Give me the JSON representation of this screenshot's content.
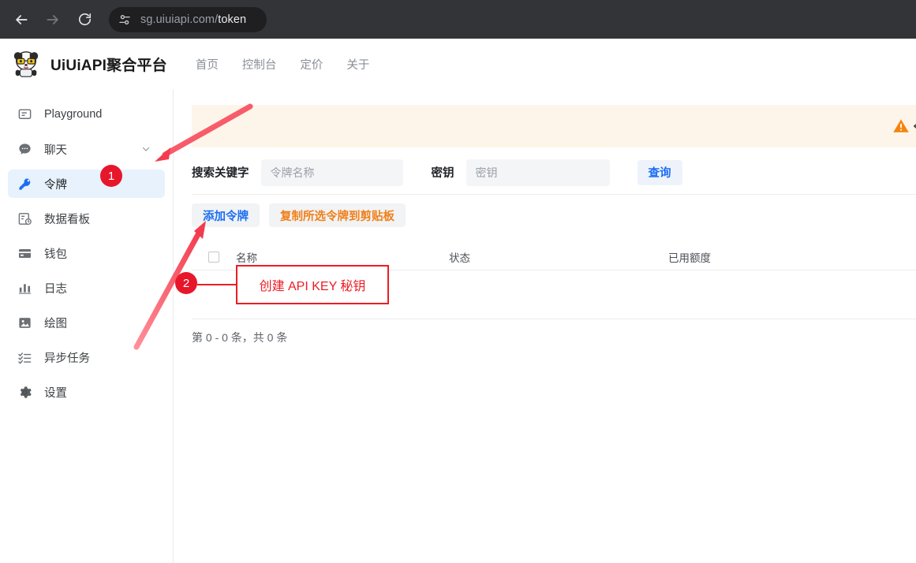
{
  "browser": {
    "back_icon": "arrow-left-icon",
    "forward_icon": "arrow-right-icon",
    "reload_icon": "reload-icon",
    "site_settings_icon": "site-settings-sliders-icon",
    "url_prefix": "sg.uiuiapi.com/",
    "url_suffix": "token",
    "url_full": "sg.uiuiapi.com/token"
  },
  "header": {
    "logo_icon": "panda-mascot-logo",
    "brand": "UiUiAPI聚合平台",
    "nav": [
      {
        "label": "首页",
        "name": "nav-home"
      },
      {
        "label": "控制台",
        "name": "nav-console"
      },
      {
        "label": "定价",
        "name": "nav-pricing"
      },
      {
        "label": "关于",
        "name": "nav-about"
      }
    ]
  },
  "sidebar": {
    "items": [
      {
        "label": "Playground",
        "icon": "message-box-icon",
        "active": false,
        "expandable": false
      },
      {
        "label": "聊天",
        "icon": "chat-bubble-icon",
        "active": false,
        "expandable": true
      },
      {
        "label": "令牌",
        "icon": "key-icon",
        "active": true,
        "expandable": false
      },
      {
        "label": "数据看板",
        "icon": "dashboard-report-icon",
        "active": false,
        "expandable": false
      },
      {
        "label": "钱包",
        "icon": "wallet-card-icon",
        "active": false,
        "expandable": false
      },
      {
        "label": "日志",
        "icon": "bar-chart-icon",
        "active": false,
        "expandable": false
      },
      {
        "label": "绘图",
        "icon": "image-icon",
        "active": false,
        "expandable": false
      },
      {
        "label": "异步任务",
        "icon": "checklist-icon",
        "active": false,
        "expandable": false
      },
      {
        "label": "设置",
        "icon": "gear-icon",
        "active": false,
        "expandable": false
      }
    ]
  },
  "main": {
    "warning_banner": {
      "icon": "warning-triangle-icon",
      "text": "",
      "background_color": "#fdf5e9",
      "icon_color": "#f5840c"
    },
    "filters": {
      "keyword_label": "搜索关键字",
      "keyword_placeholder": "令牌名称",
      "keyword_value": "",
      "secret_label": "密钥",
      "secret_placeholder": "密钥",
      "secret_value": "",
      "query_button": "查询"
    },
    "actions": {
      "add_token": "添加令牌",
      "copy_selected": "复制所选令牌到剪贴板"
    },
    "table": {
      "columns": [
        "名称",
        "状态",
        "已用额度"
      ],
      "rows": [],
      "select_all_checked": false
    },
    "pagination": "第 0 - 0 条，共 0 条"
  },
  "annotations": {
    "badge_1": "1",
    "badge_2": "2",
    "callout_text": "创建 API KEY 秘钥",
    "accent_color": "#ed1c24"
  }
}
